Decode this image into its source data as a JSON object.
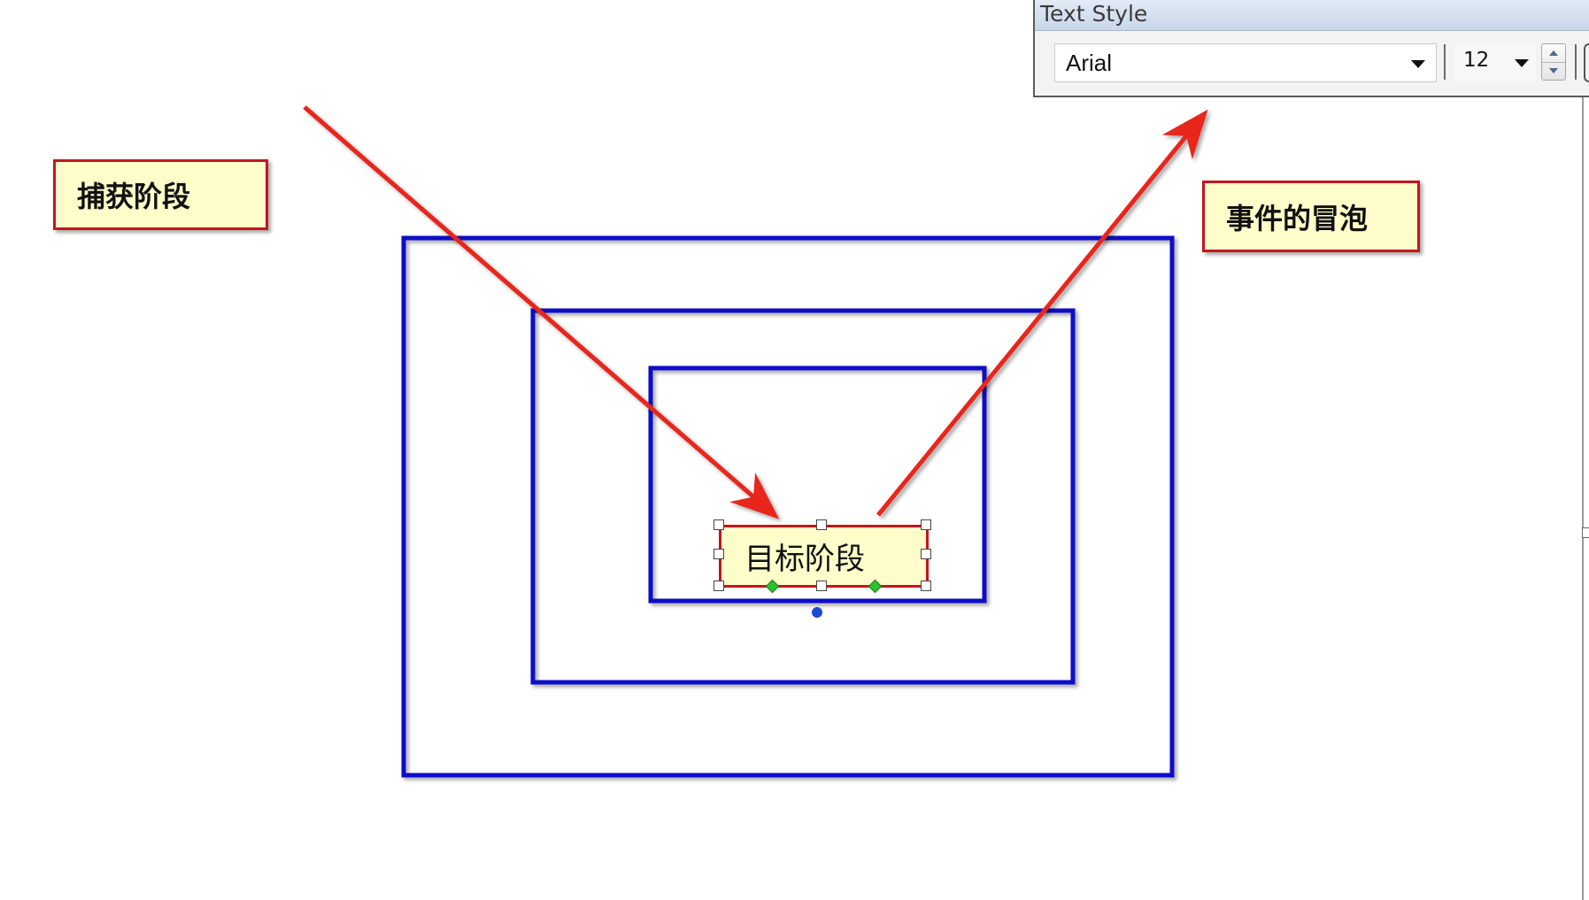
{
  "toolbar": {
    "title": "Text Style",
    "font_family_value": "Arial",
    "font_size_value": "12"
  },
  "diagram": {
    "capture_label": "捕获阶段",
    "bubble_label": "事件的冒泡",
    "target_label": "目标阶段"
  },
  "colors": {
    "nested_rect_stroke": "#1010c8",
    "arrow": "#e8261c",
    "label_fill": "#fffdca",
    "label_border": "#c8141e",
    "selection_handle_diamond": "#2fbf2f",
    "rotate_handle": "#1a4cd6"
  },
  "icons": [
    "dropdown-arrow-icon",
    "spin-up-icon",
    "spin-down-icon"
  ]
}
